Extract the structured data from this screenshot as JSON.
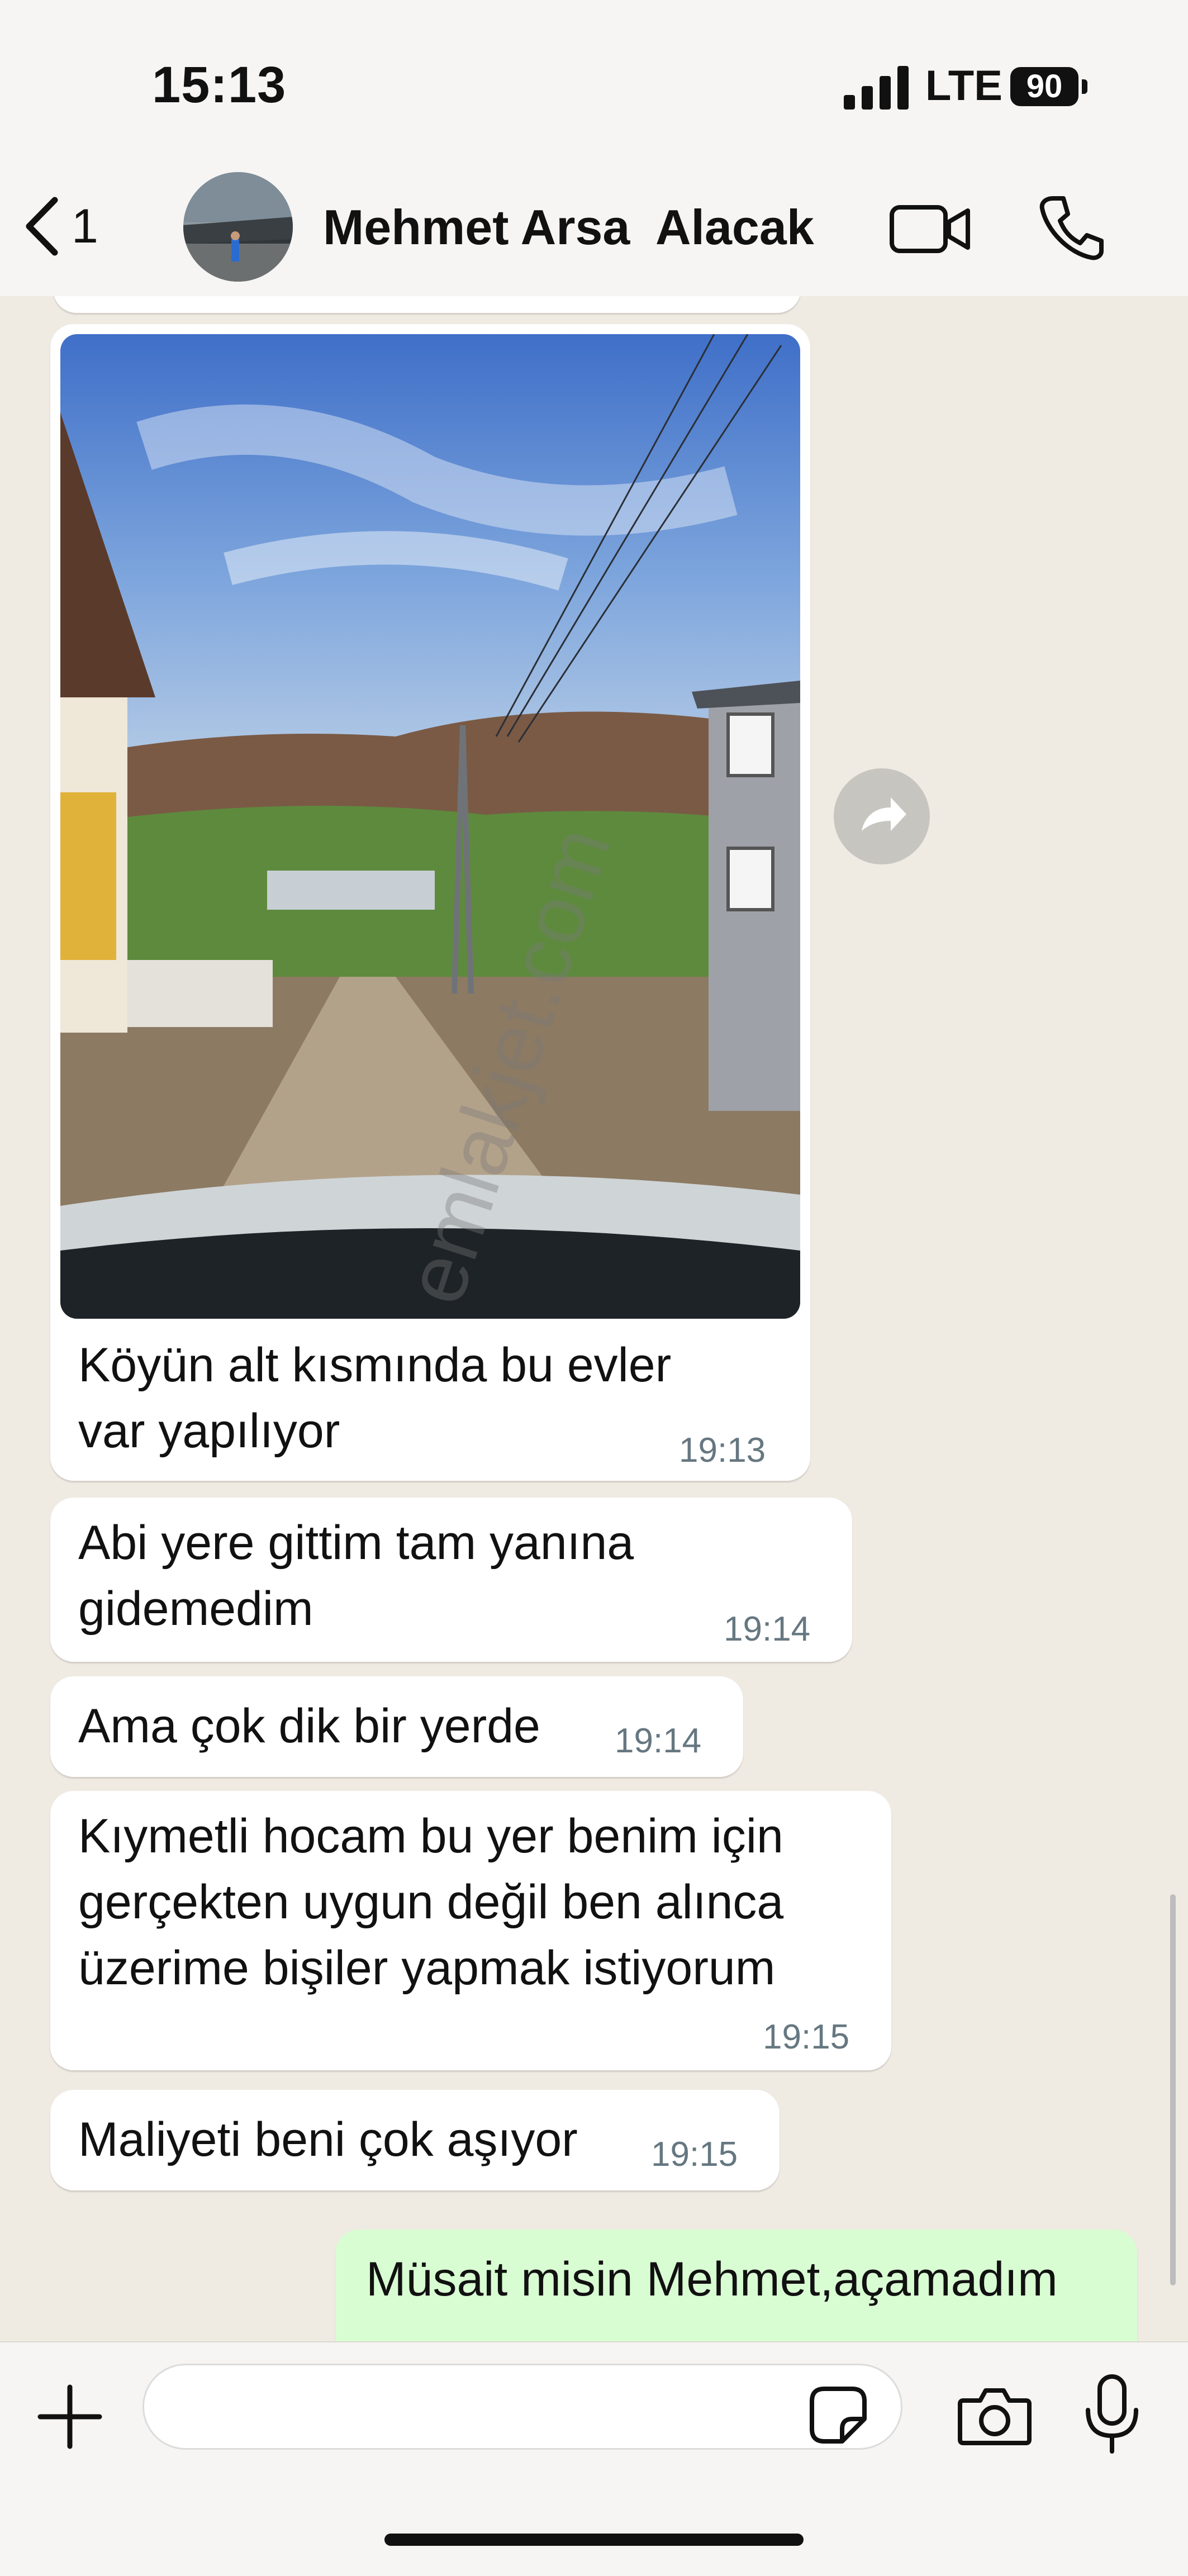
{
  "status_bar": {
    "time": "15:13",
    "network": "LTE",
    "battery": "90"
  },
  "header": {
    "back_count": "1",
    "contact_name": "Mehmet Arsa  Alacak"
  },
  "messages": [
    {
      "lines": [
        "Köyün alt kısmında bu evler",
        "var yapılıyor"
      ],
      "time": "19:13"
    },
    {
      "lines": [
        "Abi yere gittim tam yanına",
        "gidemedim"
      ],
      "time": "19:14"
    },
    {
      "lines": [
        "Ama çok dik bir yerde"
      ],
      "time": "19:14"
    },
    {
      "lines": [
        "Kıymetli hocam bu yer benim için",
        "gerçekten uygun değil ben alınca",
        "üzerime bişiler yapmak istiyorum"
      ],
      "time": "19:15"
    },
    {
      "lines": [
        "Maliyeti beni çok aşıyor"
      ],
      "time": "19:15"
    },
    {
      "lines": [
        "Müsait misin Mehmet,açamadım"
      ]
    }
  ],
  "watermark": "emlakjet.com",
  "composer": {
    "placeholder": ""
  },
  "colors": {
    "chat_background": "#efeae2",
    "incoming_bubble": "#ffffff",
    "outgoing_bubble": "#d9fdd3",
    "timestamp": "#667781"
  }
}
